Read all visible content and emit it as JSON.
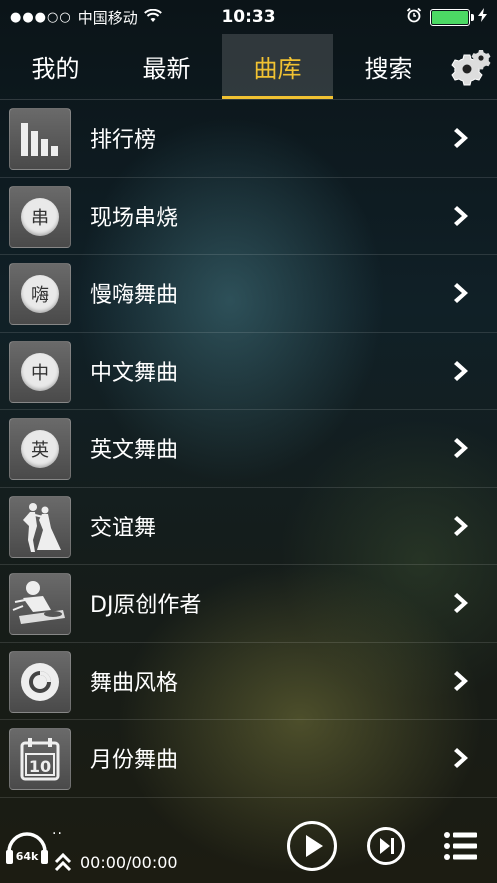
{
  "status_bar": {
    "signal": "●●●○○",
    "carrier": "中国移动",
    "time": "10:33",
    "battery_color": "#4cd964"
  },
  "tabs": [
    {
      "label": "我的"
    },
    {
      "label": "最新"
    },
    {
      "label": "曲库",
      "active": true
    },
    {
      "label": "搜索"
    }
  ],
  "accent_color": "#f1c232",
  "list": [
    {
      "label": "排行榜",
      "icon": "bar-chart-icon"
    },
    {
      "label": "现场串烧",
      "icon": "circle-char-icon",
      "glyph": "串"
    },
    {
      "label": "慢嗨舞曲",
      "icon": "circle-char-icon",
      "glyph": "嗨"
    },
    {
      "label": "中文舞曲",
      "icon": "circle-char-icon",
      "glyph": "中"
    },
    {
      "label": "英文舞曲",
      "icon": "circle-char-icon",
      "glyph": "英"
    },
    {
      "label": "交谊舞",
      "icon": "dancers-icon"
    },
    {
      "label": "DJ原创作者",
      "icon": "dj-icon"
    },
    {
      "label": "舞曲风格",
      "icon": "disc-icon"
    },
    {
      "label": "月份舞曲",
      "icon": "calendar-icon",
      "glyph": "10"
    }
  ],
  "player": {
    "bitrate": "64k",
    "track_dots": "..",
    "time": "00:00/00:00"
  }
}
